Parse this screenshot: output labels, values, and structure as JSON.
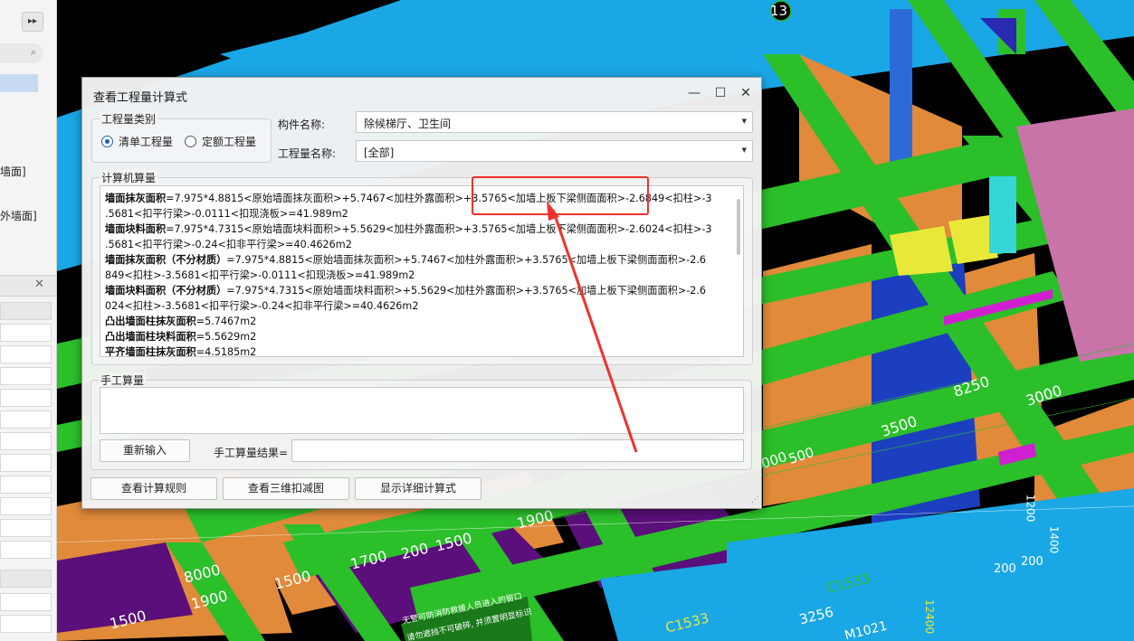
{
  "left_panel": {
    "expand_label": "▸▸",
    "search_icon": "search-icon",
    "truncated_items": [
      "墙面]",
      "外墙面]"
    ],
    "close_label": "✕",
    "collapse_label": "‹"
  },
  "viewport": {
    "axis_labels": [
      "13",
      "8250",
      "3000",
      "3500",
      "000",
      "500",
      "1900",
      "200",
      "1500",
      "1700",
      "8000",
      "1500",
      "1900",
      "1500",
      "C1533",
      "C1533",
      "3256",
      "M1021",
      "200",
      "200",
      "1200",
      "1400",
      "12400"
    ],
    "sign_text": [
      "无警可防消防救援人员进入的窗口",
      "请勿遮挡不可破碎, 并须置明显标识"
    ],
    "colors": {
      "background": "#000000",
      "beam_green": "#2bbf2a",
      "wall_orange": "#e08a3a",
      "slab_blue": "#1aa7e6",
      "column_blue": "#1c3fbf",
      "purple": "#5a0f7a",
      "magenta": "#d01fd0",
      "yellow": "#e8e83a",
      "pink": "#c874a8",
      "cyan": "#35d6d6"
    }
  },
  "dialog": {
    "title": "查看工程量计算式",
    "window_buttons": {
      "minimize": "—",
      "maximize": "☐",
      "close": "✕"
    },
    "quantity_type": {
      "label": "工程量类别",
      "options": [
        {
          "label": "清单工程量",
          "selected": true
        },
        {
          "label": "定额工程量",
          "selected": false
        }
      ]
    },
    "component_name": {
      "label": "构件名称:",
      "value": "除候梯厅、卫生间"
    },
    "quantity_name": {
      "label": "工程量名称:",
      "value": "[全部]"
    },
    "computer_calc": {
      "label": "计算机算量",
      "lines": [
        {
          "bold": "墙面抹灰面积",
          "text": "=7.975*4.8815<原始墙面抹灰面积>+5.7467<加柱外露面积>+3.5765<加墙上板下梁侧面面积>-2.6849<扣柱>-3"
        },
        {
          "bold": "",
          "text": ".5681<扣平行梁>-0.0111<扣现浇板>=41.989m2"
        },
        {
          "bold": "墙面块料面积",
          "text": "=7.975*4.7315<原始墙面块料面积>+5.5629<加柱外露面积>+3.5765<加墙上板下梁侧面面积>-2.6024<扣柱>-3"
        },
        {
          "bold": "",
          "text": ".5681<扣平行梁>-0.24<扣非平行梁>=40.4626m2"
        },
        {
          "bold": "墙面抹灰面积（不分材质）",
          "text": "=7.975*4.8815<原始墙面抹灰面积>+5.7467<加柱外露面积>+3.5765<加墙上板下梁侧面面积>-2.6"
        },
        {
          "bold": "",
          "text": "849<扣柱>-3.5681<扣平行梁>-0.0111<扣现浇板>=41.989m2"
        },
        {
          "bold": "墙面块料面积（不分材质）",
          "text": "=7.975*4.7315<原始墙面块料面积>+5.5629<加柱外露面积>+3.5765<加墙上板下梁侧面面积>-2.6"
        },
        {
          "bold": "",
          "text": "024<扣柱>-3.5681<扣平行梁>-0.24<扣非平行梁>=40.4626m2"
        },
        {
          "bold": "凸出墙面柱抹灰面积",
          "text": "=5.7467m2"
        },
        {
          "bold": "凸出墙面柱块料面积",
          "text": "=5.5629m2"
        },
        {
          "bold": "平齐墙面柱抹灰面积",
          "text": "=4.5185m2"
        }
      ]
    },
    "manual_calc": {
      "label": "手工算量",
      "reinput_button": "重新输入",
      "result_label": "手工算量结果="
    },
    "buttons": {
      "view_rules": "查看计算规则",
      "view_3d": "查看三维扣减图",
      "show_detail": "显示详细计算式"
    }
  }
}
